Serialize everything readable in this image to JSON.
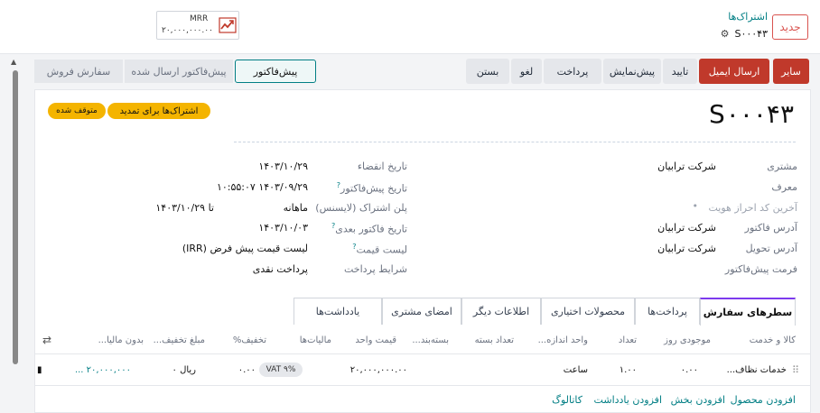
{
  "header": {
    "new_button": "جدید",
    "breadcrumb_parent": "اشتراک‌ها",
    "record_name": "S۰۰۰۴۳",
    "mrr_label": "MRR",
    "mrr_value": "۲۰,۰۰۰,۰۰۰.۰۰"
  },
  "actions": {
    "buttons": [
      "سایر",
      "ارسال ایمیل",
      "تایید",
      "پیش‌نمایش",
      "پرداخت",
      "لغو",
      "بستن"
    ],
    "stages": [
      "پیش‌فاکتور",
      "پیش‌فاکتور ارسال شده",
      "سفارش فروش"
    ]
  },
  "record": {
    "title": "S۰۰۰۴۳",
    "ribbon_renew": "اشتراک‌ها برای تمدید",
    "ribbon_paused": "متوقف شده"
  },
  "form_right": {
    "labels": [
      "مشتری",
      "معرف",
      "آخرین کد احراز هویت",
      "آدرس فاکتور",
      "آدرس تحویل",
      "فرمت پیش‌فاکتور"
    ],
    "customer": "شرکت ترابیان",
    "invoice_address": "شرکت ترابیان",
    "delivery_address": "شرکت ترابیان"
  },
  "form_left": {
    "labels": [
      "تاریخ انقضاء",
      "تاریخ پیش‌فاکتور",
      "پلن اشتراک (لایسنس)",
      "تاریخ فاکتور بعدی",
      "لیست قیمت",
      "شرایط پرداخت"
    ],
    "expiration": "۱۴۰۳/۱۰/۲۹",
    "quotation_date": "۱۴۰۳/۰۹/۲۹ ۱۰:۵۵:۰۷",
    "plan": "ماهانه",
    "plan_until": "تا ۱۴۰۳/۱۰/۲۹",
    "next_invoice": "۱۴۰۳/۱۰/۰۳",
    "pricelist": "لیست قیمت پیش فرض (IRR)",
    "payment_terms": "پرداخت نقدی"
  },
  "tabs": [
    "سطرهای سفارش",
    "پرداخت‌ها",
    "محصولات اختیاری",
    "اطلاعات دیگر",
    "امضای مشتری",
    "یادداشت‌ها"
  ],
  "table": {
    "headers": [
      "کالا و خدمت",
      "موجودی روز",
      "تعداد",
      "واحد اندازه...",
      "تعداد بسته",
      "بسته‌بند...",
      "قیمت واحد",
      "مالیات‌ها",
      "تخفیف%",
      "مبلغ تخفیف...",
      "بدون مالیا..."
    ],
    "row": {
      "product": "خدمات نظاف...",
      "stock": "۰.۰۰",
      "qty": "۱.۰۰",
      "uom": "ساعت",
      "unit_price": "۲۰,۰۰۰,۰۰۰.۰۰",
      "tax": "VAT ۹%",
      "discount": "۰.۰۰",
      "discount_amount": "ریال ۰",
      "subtotal": "۲۰,۰۰۰,۰۰۰ ..."
    },
    "add_links": [
      "افزودن محصول",
      "افزودن بخش",
      "افزودن یادداشت",
      "کاتالوگ"
    ]
  }
}
